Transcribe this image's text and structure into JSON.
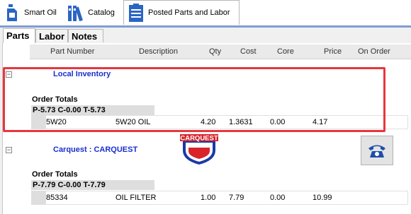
{
  "top_tabs": [
    {
      "label": "Smart Oil",
      "icon": "oil-bottle-icon"
    },
    {
      "label": "Catalog",
      "icon": "catalog-books-icon"
    },
    {
      "label": "Posted Parts and Labor",
      "icon": "clipboard-list-icon"
    }
  ],
  "sub_tabs": [
    "Parts",
    "Labor",
    "Notes"
  ],
  "columns": [
    "Part Number",
    "Description",
    "Qty",
    "Cost",
    "Core",
    "Price",
    "On Order"
  ],
  "groups": [
    {
      "vendor": "Local Inventory",
      "order_totals_label": "Order Totals",
      "totals": "P-5.73 C-0.00 T-5.73",
      "row": {
        "part_number": "5W20",
        "description": "5W20 OIL",
        "qty": "4.20",
        "cost": "1.3631",
        "core": "0.00",
        "price": "4.17"
      }
    },
    {
      "vendor": "Carquest : CARQUEST",
      "logo_text": "CARQUEST",
      "order_totals_label": "Order Totals",
      "totals": "P-7.79 C-0.00 T-7.79",
      "row": {
        "part_number": "85334",
        "description": "OIL FILTER",
        "qty": "1.00",
        "cost": "7.79",
        "core": "0.00",
        "price": "10.99"
      }
    }
  ],
  "colors": {
    "vendor_text": "#1a2fcf",
    "highlight": "#e8363e",
    "tab_strip": "#7f9dd3"
  }
}
